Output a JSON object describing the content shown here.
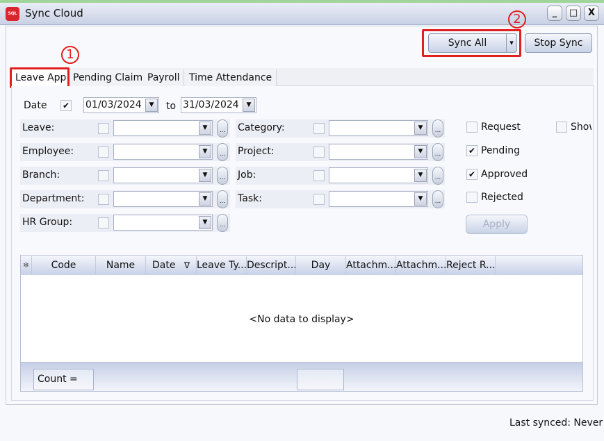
{
  "window": {
    "title": "Sync Cloud",
    "app_icon_text": "SQL PAY",
    "minimize": "_",
    "maximize": "□",
    "close": "X"
  },
  "toolbar": {
    "sync_all": "Sync All",
    "sync_dropdown": "▾",
    "stop_sync": "Stop Sync"
  },
  "annotations": {
    "marker_1": "1",
    "marker_2": "2",
    "highlight_color": "#e02020"
  },
  "tabs": [
    {
      "label": "Leave App",
      "active": true
    },
    {
      "label": "Pending Claim"
    },
    {
      "label": "Payroll"
    },
    {
      "label": "Time Attendance"
    }
  ],
  "date_filter": {
    "label": "Date",
    "checked": true,
    "from": "01/03/2024",
    "to_label": "to",
    "to": "31/03/2024"
  },
  "filters_left": [
    {
      "label": "Leave:",
      "value": ""
    },
    {
      "label": "Employee:",
      "value": ""
    },
    {
      "label": "Branch:",
      "value": ""
    },
    {
      "label": "Department:",
      "value": ""
    },
    {
      "label": "HR Group:",
      "value": ""
    }
  ],
  "filters_right": [
    {
      "label": "Category:",
      "value": ""
    },
    {
      "label": "Project:",
      "value": ""
    },
    {
      "label": "Job:",
      "value": ""
    },
    {
      "label": "Task:",
      "value": ""
    }
  ],
  "ellipsis": "...",
  "status": [
    {
      "label": "Request",
      "checked": false
    },
    {
      "label": "Pending",
      "checked": true
    },
    {
      "label": "Approved",
      "checked": true
    },
    {
      "label": "Rejected",
      "checked": false
    }
  ],
  "show_label": "Show",
  "apply": "Apply",
  "grid": {
    "columns": [
      "✻",
      "Code",
      "Name",
      "Date",
      "Leave Ty...",
      "Descript...",
      "Day",
      "Attachm...",
      "Attachm...",
      "Reject R..."
    ],
    "sort_icon": "∇",
    "empty_text": "<No data to display>",
    "count_label": "Count =",
    "summary": ""
  },
  "footer": {
    "last_synced": "Last synced: Never"
  }
}
